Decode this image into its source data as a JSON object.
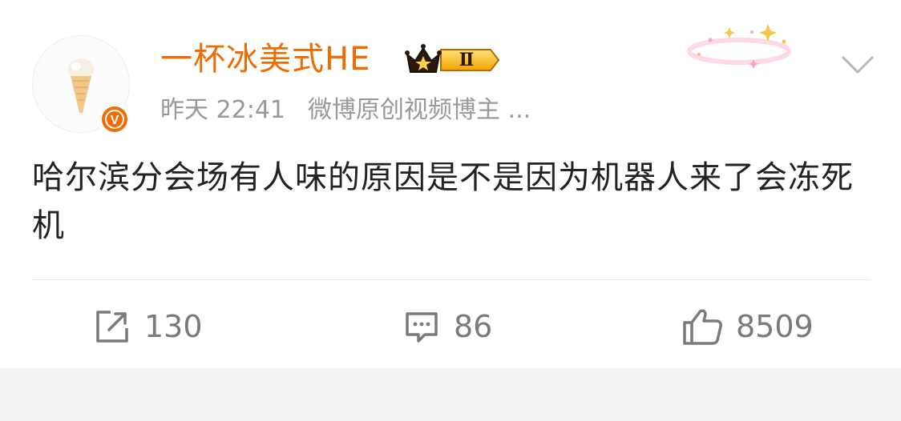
{
  "author": {
    "name": "一杯冰美式HE",
    "vip_level": "Ⅱ",
    "verified_badge": "V",
    "avatar_icon": "ice-cream-cone-icon"
  },
  "meta": {
    "time": "昨天 22:41",
    "source": "微博原创视频博主 ..."
  },
  "post": {
    "text": "哈尔滨分会场有人味的原因是不是因为机器人来了会冻死机"
  },
  "actions": {
    "repost_count": "130",
    "comment_count": "86",
    "like_count": "8509"
  },
  "colors": {
    "username": "#f06b00",
    "meta_text": "#999999",
    "body_text": "#222222",
    "icon_gray": "#7a7a7a",
    "badge_orange": "#f36c00"
  }
}
